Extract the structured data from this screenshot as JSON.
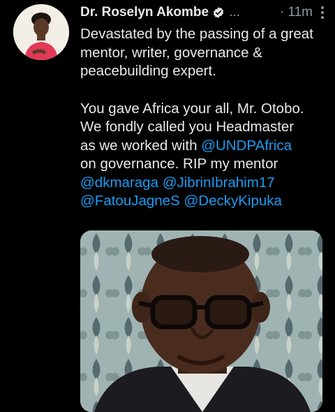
{
  "author": {
    "name": "Dr. Roselyn Akombe",
    "truncation": "...",
    "time": "11m"
  },
  "tweet": {
    "para1": "Devastated by the passing of a great mentor, writer, governance & peacebuilding expert.",
    "para2_line1": "You gave Africa your all, Mr. Otobo.",
    "para2_line2": "We fondly called you Headmaster",
    "para2_line3_pre": "as we worked with ",
    "mention1": "@UNDPAfrica",
    "para2_line4": "on governance. RIP my mentor",
    "mention2": "@dkmaraga",
    "mention3": "@JibrinIbrahim17",
    "mention4": "@FatouJagneS",
    "mention5": "@DeckyKipuka"
  },
  "colors": {
    "background": "#000000",
    "text": "#e7e9ea",
    "secondary": "#8b98a5",
    "link": "#1d9bf0"
  },
  "icons": {
    "verified": "verified-badge-icon",
    "more": "more-vertical-icon"
  }
}
